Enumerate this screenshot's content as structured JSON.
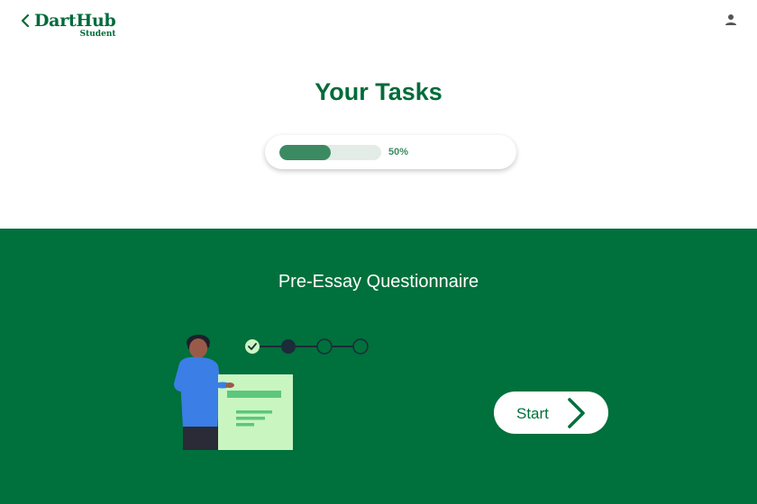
{
  "header": {
    "brand_name": "DartHub",
    "brand_subtitle": "Student",
    "back_icon": "chevron-left-icon",
    "user_icon": "user-icon"
  },
  "page": {
    "title": "Your Tasks"
  },
  "progress": {
    "value_percent": 50,
    "label": "50%"
  },
  "task": {
    "title": "Pre-Essay Questionnaire",
    "start_label": "Start",
    "start_icon": "chevron-right-icon",
    "steps": [
      "complete",
      "current",
      "pending",
      "pending"
    ]
  },
  "colors": {
    "brand_green": "#006b3a",
    "panel_green": "#00703c",
    "progress_fill": "#3c8a62",
    "white": "#ffffff"
  }
}
